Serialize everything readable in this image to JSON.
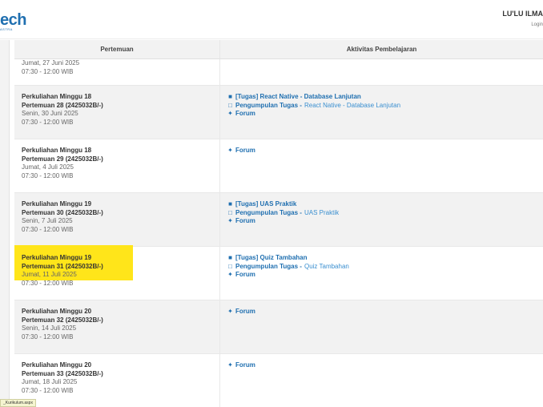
{
  "header": {
    "logo_text": "ech",
    "logo_sub": "ASTRA",
    "user_name": "LU'LU ILMA",
    "login_link": "Login"
  },
  "table": {
    "col_meeting": "Pertemuan",
    "col_activity": "Aktivitas Pembelajaran",
    "rows": [
      {
        "title": "",
        "meeting": "",
        "date": "Jumat, 27 Juni 2025",
        "time": "07:30 - 12:00 WIB",
        "activities": []
      },
      {
        "title": "Perkuliahan Minggu 18",
        "meeting": "Pertemuan 28 (2425032B/-)",
        "date": "Senin, 30 Juni 2025",
        "time": "07:30 - 12:00 WIB",
        "activities": [
          {
            "icon": "file-icon",
            "title": "[Tugas] React Native - Database Lanjutan",
            "sub": ""
          },
          {
            "icon": "upload-icon",
            "title": "Pengumpulan Tugas -",
            "sub": "React Native - Database Lanjutan"
          },
          {
            "icon": "users-icon",
            "title": "Forum",
            "sub": ""
          }
        ]
      },
      {
        "title": "Perkuliahan Minggu 18",
        "meeting": "Pertemuan 29 (2425032B/-)",
        "date": "Jumat, 4 Juli 2025",
        "time": "07:30 - 12:00 WIB",
        "activities": [
          {
            "icon": "users-icon",
            "title": "Forum",
            "sub": ""
          }
        ]
      },
      {
        "title": "Perkuliahan Minggu 19",
        "meeting": "Pertemuan 30 (2425032B/-)",
        "date": "Senin, 7 Juli 2025",
        "time": "07:30 - 12:00 WIB",
        "activities": [
          {
            "icon": "file-icon",
            "title": "[Tugas] UAS Praktik",
            "sub": ""
          },
          {
            "icon": "upload-icon",
            "title": "Pengumpulan Tugas -",
            "sub": "UAS Praktik"
          },
          {
            "icon": "users-icon",
            "title": "Forum",
            "sub": ""
          }
        ]
      },
      {
        "title": "Perkuliahan Minggu 19",
        "meeting": "Pertemuan 31 (2425032B/-)",
        "date": "Jumat, 11 Juli 2025",
        "time": "07:30 - 12:00 WIB",
        "highlighted": true,
        "activities": [
          {
            "icon": "file-icon",
            "title": "[Tugas] Quiz Tambahan",
            "sub": ""
          },
          {
            "icon": "upload-icon",
            "title": "Pengumpulan Tugas -",
            "sub": "Quiz Tambahan"
          },
          {
            "icon": "users-icon",
            "title": "Forum",
            "sub": ""
          }
        ]
      },
      {
        "title": "Perkuliahan Minggu 20",
        "meeting": "Pertemuan 32 (2425032B/-)",
        "date": "Senin, 14 Juli 2025",
        "time": "07:30 - 12:00 WIB",
        "activities": [
          {
            "icon": "users-icon",
            "title": "Forum",
            "sub": ""
          }
        ]
      },
      {
        "title": "Perkuliahan Minggu 20",
        "meeting": "Pertemuan 33 (2425032B/-)",
        "date": "Jumat, 18 Juli 2025",
        "time": "07:30 - 12:00 WIB",
        "activities": [
          {
            "icon": "users-icon",
            "title": "Forum",
            "sub": ""
          }
        ]
      }
    ]
  },
  "status_bar": "_Kurikulum.aspx",
  "colors": {
    "link": "#1f6fb0",
    "highlight": "#ffe51a",
    "row_shade": "#f2f2f2"
  }
}
